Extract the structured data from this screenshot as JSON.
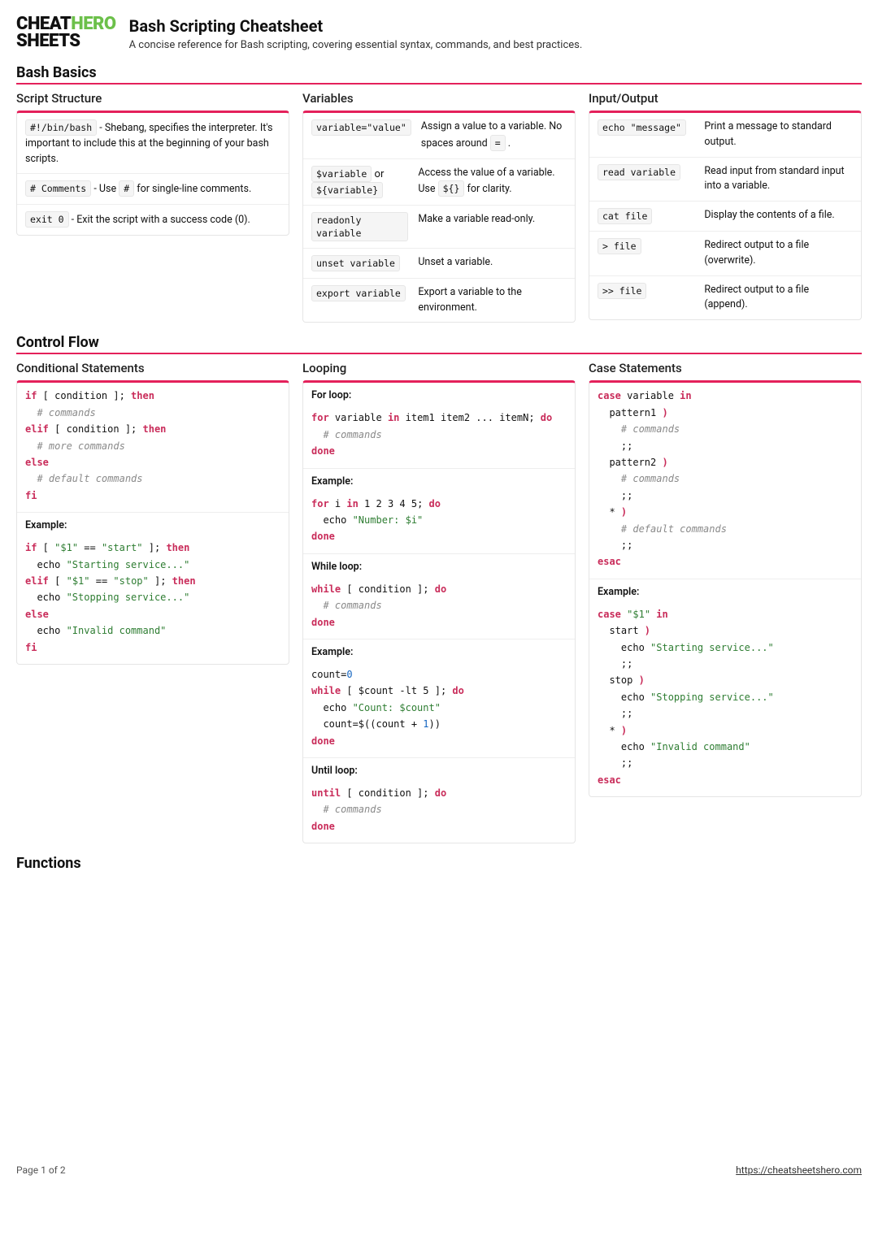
{
  "logo": {
    "l1a": "CHEAT",
    "l1b": "HERO",
    "l2": "SHEETS"
  },
  "title": "Bash Scripting Cheatsheet",
  "subtitle": "A concise reference for Bash scripting, covering essential syntax, commands, and best practices.",
  "sections": {
    "basics": "Bash Basics",
    "control": "Control Flow",
    "functions": "Functions"
  },
  "script_structure": {
    "title": "Script Structure",
    "rows": [
      {
        "code": "#!/bin/bash",
        "text_a": " - Shebang, specifies the interpreter. It's important to include this at the beginning of your bash scripts."
      },
      {
        "code": "# Comments",
        "text_a": " - Use ",
        "code2": "#",
        "text_b": " for single-line comments."
      },
      {
        "code": "exit 0",
        "text_a": " - Exit the script with a success code (0)."
      }
    ]
  },
  "variables": {
    "title": "Variables",
    "rows": [
      {
        "k": "variable=\"value\"",
        "v_a": "Assign a value to a variable. No spaces around ",
        "v_code": "=",
        "v_b": " ."
      },
      {
        "k1": "$variable",
        "k_join": " or ",
        "k2": "${variable}",
        "v_a": "Access the value of a variable. Use ",
        "v_code": "${}",
        "v_b": " for clarity."
      },
      {
        "k": "readonly variable",
        "v": "Make a variable read-only."
      },
      {
        "k": "unset variable",
        "v": "Unset a variable."
      },
      {
        "k": "export variable",
        "v": "Export a variable to the environment."
      }
    ]
  },
  "io": {
    "title": "Input/Output",
    "rows": [
      {
        "k": "echo \"message\"",
        "v": "Print a message to standard output."
      },
      {
        "k": "read variable",
        "v": "Read input from standard input into a variable."
      },
      {
        "k": "cat file",
        "v": "Display the contents of a file."
      },
      {
        "k": "> file",
        "v": "Redirect output to a file (overwrite)."
      },
      {
        "k": ">> file",
        "v": "Redirect output to a file (append)."
      }
    ]
  },
  "cond": {
    "title": "Conditional Statements",
    "example_label": "Example:"
  },
  "loop": {
    "title": "Looping",
    "for_label": "For loop:",
    "example_label": "Example:",
    "while_label": "While loop:",
    "until_label": "Until loop:"
  },
  "case": {
    "title": "Case Statements",
    "example_label": "Example:"
  },
  "footer": {
    "page": "Page 1 of 2",
    "url": "https://cheatsheetshero.com"
  }
}
